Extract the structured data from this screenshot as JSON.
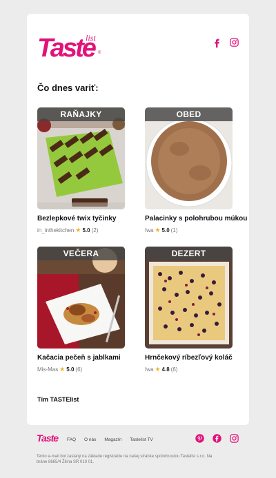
{
  "brand": {
    "logo_text": "Taste",
    "logo_sub": "list",
    "logo_mark": "®"
  },
  "heading": "Čo dnes variť:",
  "recipes": [
    {
      "category": "RAŇAJKY",
      "title": "Bezlepkové twix tyčinky",
      "author": "in_inthekitchen",
      "rating": "5.0",
      "count": "(2)"
    },
    {
      "category": "OBED",
      "title": "Palacinky s polohrubou múkou",
      "author": "Iwa",
      "rating": "5.0",
      "count": "(1)"
    },
    {
      "category": "VEČERA",
      "title": "Kačacia pečeň s jablkami",
      "author": "Mis-Mas",
      "rating": "5.0",
      "count": "(6)"
    },
    {
      "category": "DEZERT",
      "title": "Hrnčekový ríbezľový koláč",
      "author": "Iwa",
      "rating": "4.8",
      "count": "(6)"
    }
  ],
  "signoff": "Tím TASTElist",
  "footer": {
    "logo_text": "Taste",
    "nav": [
      "FAQ",
      "O nás",
      "Magazín",
      "Tastelist TV"
    ],
    "note": "Tento e-mail bol zaslaný na základe registrácie na našej stránke spoločnostou Tastelist s.r.o. Na bráne 8665/4 Žilina SR 010 01."
  },
  "colors": {
    "brand": "#e2127a",
    "star": "#f2b01e",
    "tag_bg": "#464646"
  },
  "icons": [
    "facebook-icon",
    "instagram-icon",
    "pinterest-icon",
    "star-icon"
  ]
}
